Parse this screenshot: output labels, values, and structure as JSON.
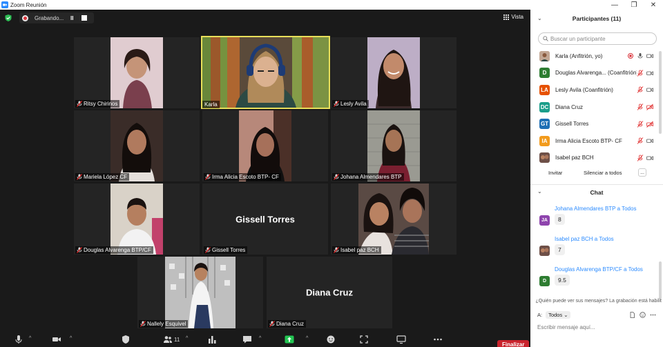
{
  "window": {
    "title": "Zoom Reunión"
  },
  "recording": {
    "label": "Grabando...",
    "pause": "II"
  },
  "view": {
    "label": "Vista"
  },
  "tiles": [
    {
      "name": "Ritsy Chirinos",
      "video": true
    },
    {
      "name": "Karla",
      "video": true,
      "active": true
    },
    {
      "name": "Lesly Avila",
      "video": true
    },
    {
      "name": "Mariela López CF",
      "video": true
    },
    {
      "name": "Irma Alicia Escoto BTP- CF",
      "video": true
    },
    {
      "name": "Johana Almendares BTP",
      "video": true
    },
    {
      "name": "Douglas Alvarenga BTP/CF",
      "video": true
    },
    {
      "name": "Gissell Torres",
      "video": false,
      "big_name": "Gissell Torres"
    },
    {
      "name": "Isabel paz BCH",
      "video": true
    },
    {
      "name": "Nallely Esquivel",
      "video": true
    },
    {
      "name": "Diana Cruz",
      "video": false,
      "big_name": "Diana Cruz"
    }
  ],
  "toolbar": {
    "participants_count": "11",
    "end_label": "Finalizar"
  },
  "participants_panel": {
    "title": "Participantes (11)",
    "search_placeholder": "Buscar un participante",
    "items": [
      {
        "name": "Karla (Anfitrión, yo)",
        "initials": "",
        "color": "#b0b0b0",
        "photo": true
      },
      {
        "name": "Douglas Alvarenga...  (Coanfitrión)",
        "initials": "D",
        "color": "#2e7d32"
      },
      {
        "name": "Lesly Avila (Coanfitrión)",
        "initials": "LA",
        "color": "#e65100"
      },
      {
        "name": "Diana Cruz",
        "initials": "DC",
        "color": "#1b9e8a"
      },
      {
        "name": "Gissell Torres",
        "initials": "GT",
        "color": "#1e6fb5"
      },
      {
        "name": "Irma Alicia Escoto BTP- CF",
        "initials": "IA",
        "color": "#f29b1d"
      },
      {
        "name": "Isabel paz BCH",
        "initials": "",
        "color": "#8d6e63",
        "photo": true
      }
    ],
    "invite": "Invitar",
    "mute_all": "Silenciar a todos",
    "more": "..."
  },
  "chat": {
    "title": "Chat",
    "messages": [
      {
        "sender": "Johana Almendares BTP a Todos",
        "initials": "JA",
        "color": "#8e44ad",
        "text": "8"
      },
      {
        "sender": "Isabel paz BCH a Todos",
        "initials": "",
        "color": "#8d6e63",
        "photo": true,
        "text": "7"
      },
      {
        "sender": "Douglas Alvarenga BTP/CF a Todos",
        "initials": "D",
        "color": "#2e7d32",
        "text": "9.5"
      }
    ],
    "notice": "¿Quién puede ver sus mensajes? La grabación está habilit",
    "to_label": "A:",
    "to_value": "Todos",
    "input_placeholder": "Escribir mensaje aquí..."
  }
}
